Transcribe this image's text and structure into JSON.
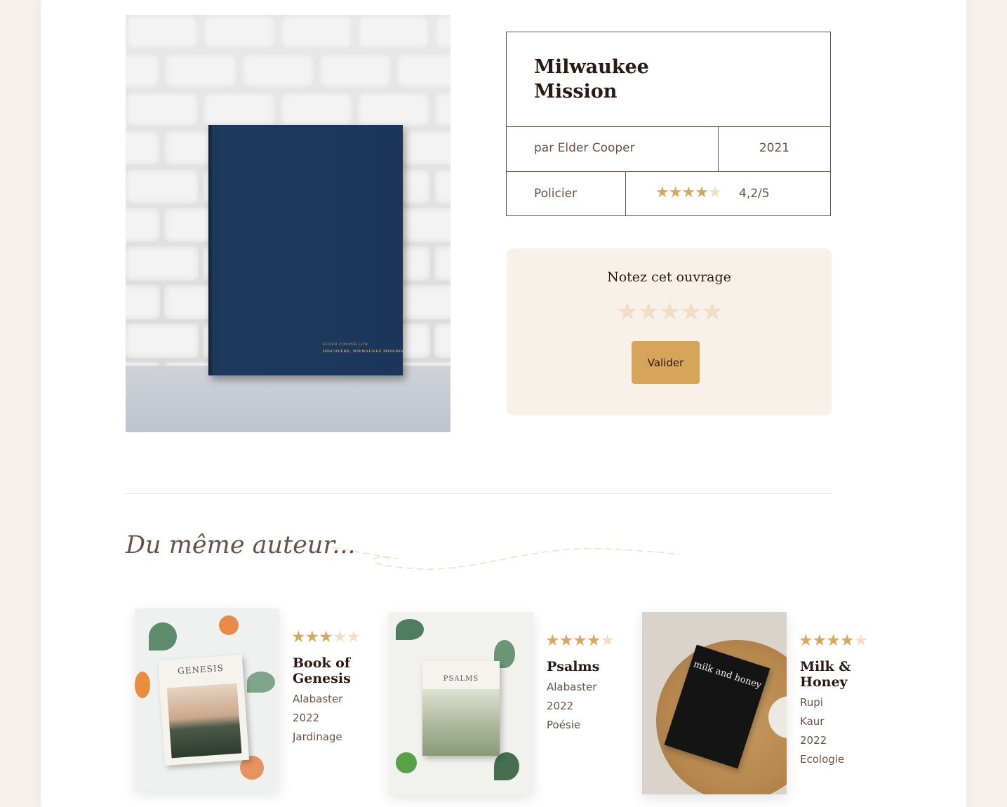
{
  "book": {
    "title": "Milwaukee Mission",
    "author": "par Elder Cooper",
    "year": "2021",
    "genre": "Policier",
    "rating_label": "4,2/5",
    "rating_value": 4.2,
    "cover_line1": "ELDER COOPER LCW",
    "cover_line2": "DISCOVERS, MILWAUKEE MISSION"
  },
  "rate_box": {
    "title": "Notez cet ouvrage",
    "button_label": "Valider"
  },
  "related": {
    "heading": "Du même auteur...",
    "items": [
      {
        "title": "Book of Genesis",
        "author": "Alabaster",
        "year": "2022",
        "genre": "Jardinage",
        "rating": 3,
        "cover_label": "GENESIS"
      },
      {
        "title": "Psalms",
        "author": "Alabaster",
        "year": "2022",
        "genre": "Poésie",
        "rating": 4,
        "cover_label": "PSALMS"
      },
      {
        "title": "Milk & Honey",
        "author": "Rupi Kaur",
        "year": "2022",
        "genre": "Ecologie",
        "rating": 4,
        "cover_label": "milk and honey"
      }
    ]
  },
  "colors": {
    "accent": "#d6a45b",
    "star_on": "#d7a860",
    "star_off": "#f0dfc6",
    "text_dark": "#2b1a14",
    "text_brown": "#6b5247",
    "panel_bg": "#f7f1ea"
  }
}
